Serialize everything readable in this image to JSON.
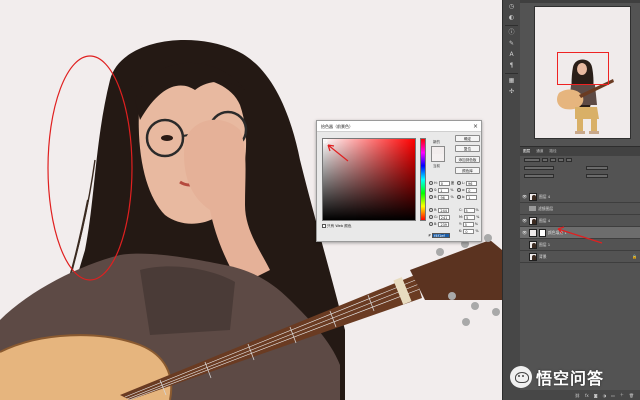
{
  "color_picker": {
    "title": "拾色器（前景色）",
    "close_glyph": "×",
    "new_label": "新的",
    "current_label": "当前",
    "buttons": [
      "确定",
      "复位",
      "添加到色板",
      "颜色库"
    ],
    "only_web_colors_label": "只有 Web 颜色",
    "hsb_fields": [
      {
        "label": "H:",
        "value": "0",
        "unit": "度"
      },
      {
        "label": "S:",
        "value": "1",
        "unit": "%"
      },
      {
        "label": "B:",
        "value": "96",
        "unit": "%"
      }
    ],
    "rgb_fields": [
      {
        "label": "R:",
        "value": "244"
      },
      {
        "label": "G:",
        "value": "241"
      },
      {
        "label": "B:",
        "value": "239"
      }
    ],
    "lab_fields": [
      {
        "label": "L:",
        "value": "96"
      },
      {
        "label": "a:",
        "value": "0"
      },
      {
        "label": "b:",
        "value": "1"
      }
    ],
    "cmyk_fields": [
      {
        "label": "C:",
        "value": "5",
        "unit": "%"
      },
      {
        "label": "M:",
        "value": "5",
        "unit": "%"
      },
      {
        "label": "Y:",
        "value": "5",
        "unit": "%"
      },
      {
        "label": "K:",
        "value": "0",
        "unit": "%"
      }
    ],
    "hex_label": "#",
    "hex_value": "f4f1ef"
  },
  "layers_panel": {
    "tabs": [
      "图层",
      "通道",
      "路径"
    ],
    "layers": [
      {
        "name": "图层 4",
        "type": "photo",
        "selected": false
      },
      {
        "name": "滤镜图层",
        "type": "group",
        "selected": false
      },
      {
        "name": "图层 4",
        "type": "photo",
        "selected": false
      },
      {
        "name": "颜色填充 1",
        "type": "fill",
        "selected": true
      },
      {
        "name": "图层 1",
        "type": "photo",
        "selected": false
      },
      {
        "name": "背景",
        "type": "photo",
        "selected": false
      }
    ],
    "bottom_icons": [
      "link-icon",
      "fx-icon",
      "mask-icon",
      "adjustment-icon",
      "folder-icon",
      "new-layer-icon",
      "trash-icon"
    ]
  },
  "toolstrip_icons": [
    "history-icon",
    "adjust-icon",
    "info-icon",
    "brush-icon",
    "type-icon",
    "paragraph-icon",
    "swatch-icon",
    "glyph-icon"
  ],
  "watermark": {
    "text": "悟空问答"
  },
  "colors": {
    "annotation_red": "#e02020",
    "canvas_bg": "#f2eded",
    "panel_bg": "#535353",
    "selection_blue": "#1d5fa9"
  }
}
